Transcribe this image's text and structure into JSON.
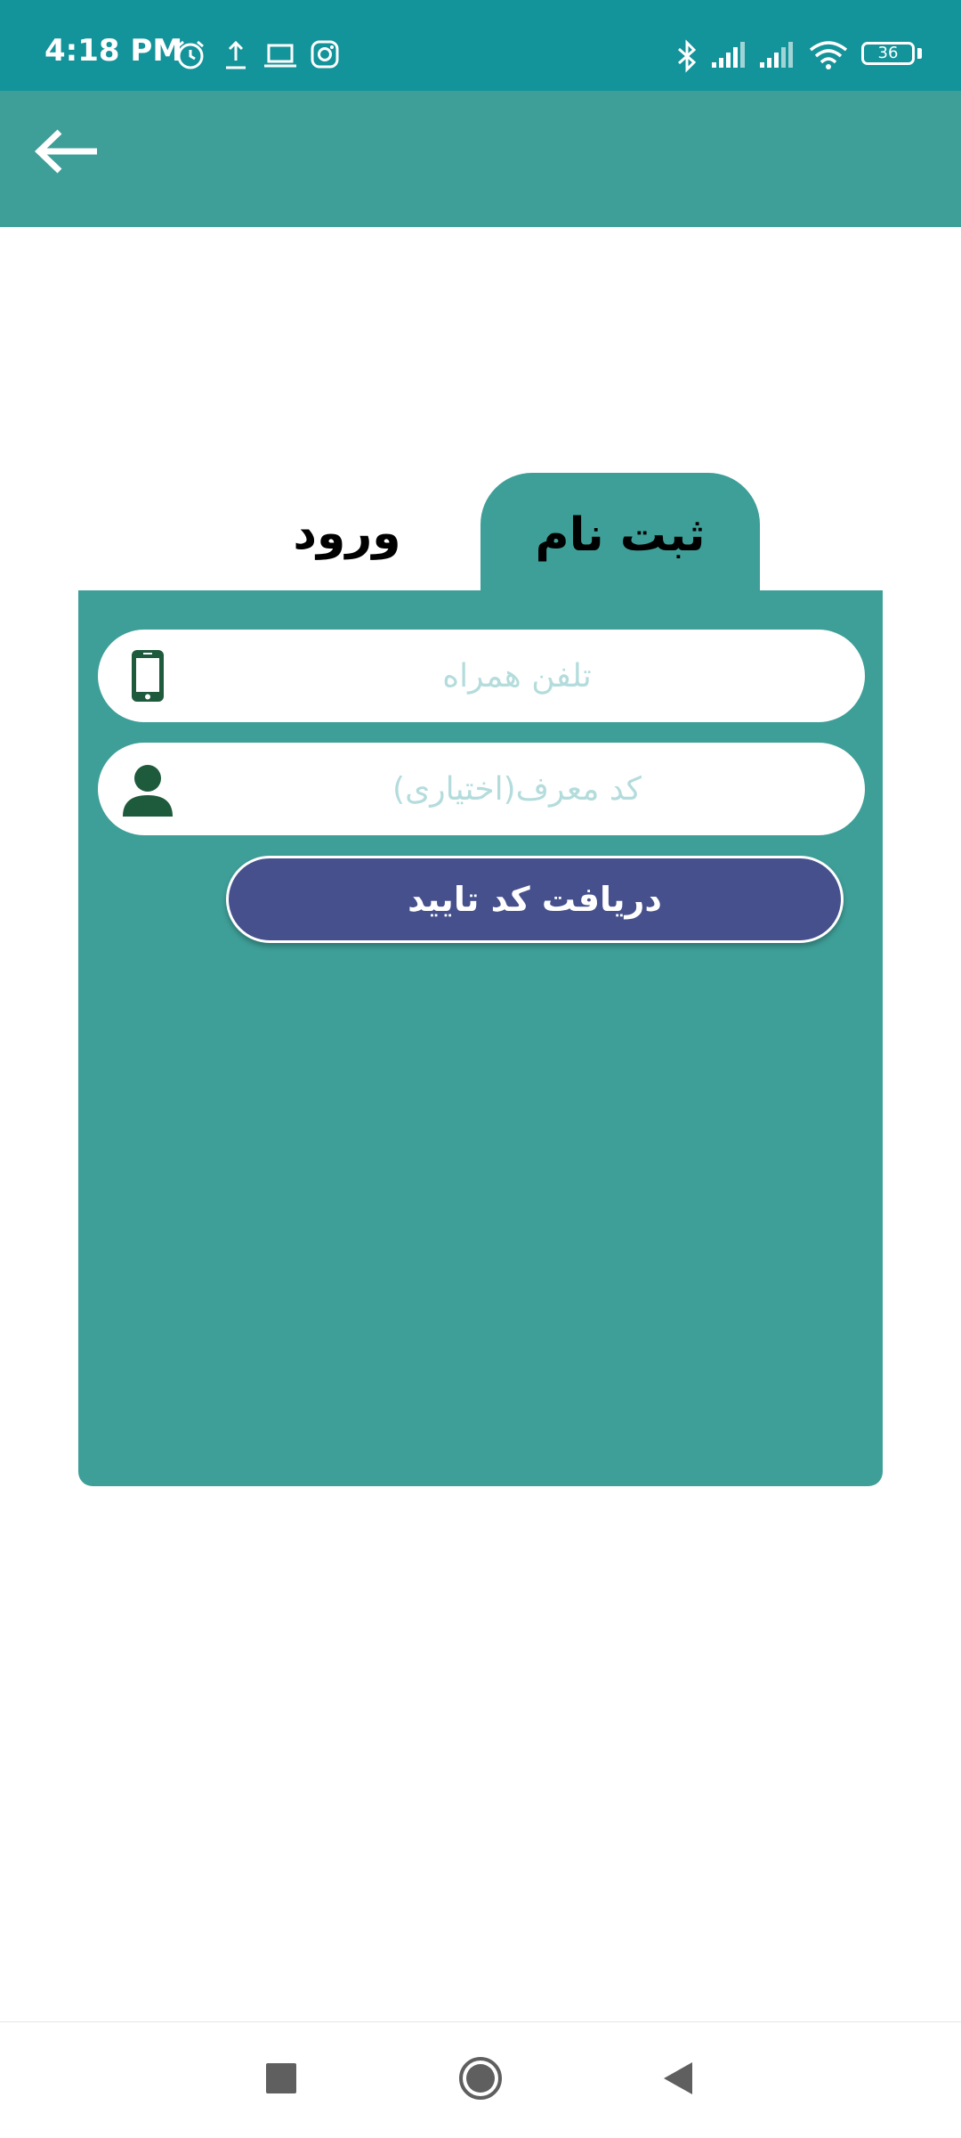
{
  "status_bar": {
    "time": "4:18 PM",
    "battery_level": "36",
    "left_icons": [
      "alarm-icon",
      "upload-icon",
      "laptop-icon",
      "instagram-icon"
    ],
    "right_icons": [
      "bluetooth-icon",
      "signal-icon",
      "signal-icon",
      "wifi-icon",
      "battery-icon"
    ]
  },
  "app_bar": {
    "back_icon": "arrow-left-icon"
  },
  "tabs": {
    "register_label": "ثبت نام",
    "login_label": "ورود",
    "active": "register"
  },
  "form": {
    "phone_placeholder": "تلفن همراه",
    "phone_value": "",
    "phone_icon": "mobile-phone-icon",
    "referral_placeholder": "کد معرف(اختیاری)",
    "referral_value": "",
    "referral_icon": "user-icon",
    "submit_label": "دریافت کد تایید"
  },
  "nav_bar": {
    "items": [
      "recents-square-icon",
      "home-circle-icon",
      "back-triangle-icon"
    ]
  },
  "colors": {
    "status_bar": "#13939a",
    "primary": "#3e9f98",
    "button": "#46508c",
    "icon_dark": "#1e5a3c",
    "placeholder": "#b4dcdc"
  }
}
